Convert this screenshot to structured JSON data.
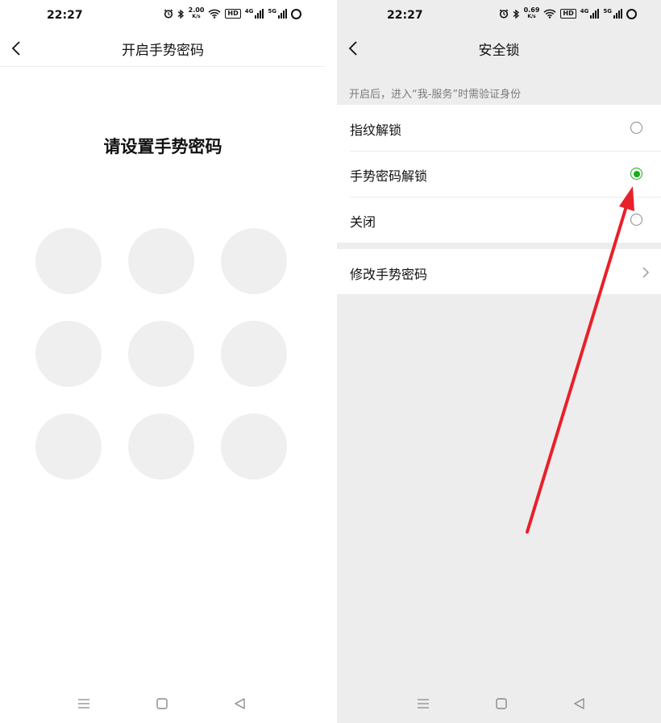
{
  "left": {
    "status": {
      "time": "22:27",
      "speed_value": "2.00",
      "speed_unit": "K/s",
      "hd": "HD",
      "net1": "4G",
      "net2": "5G"
    },
    "title": "开启手势密码",
    "prompt": "请设置手势密码",
    "pattern_dots": 9
  },
  "right": {
    "status": {
      "time": "22:27",
      "speed_value": "0.69",
      "speed_unit": "K/s",
      "hd": "HD",
      "net1": "4G",
      "net2": "5G"
    },
    "title": "安全锁",
    "hint": "开启后，进入“我-服务”时需验证身份",
    "options": [
      {
        "label": "指纹解锁",
        "selected": false
      },
      {
        "label": "手势密码解锁",
        "selected": true
      },
      {
        "label": "关闭",
        "selected": false
      }
    ],
    "modify_label": "修改手势密码"
  },
  "colors": {
    "accent": "#1aad19",
    "annotation_arrow": "#e8202a",
    "right_bg": "#ededed",
    "dot": "#efefef"
  },
  "icons": [
    "back-icon",
    "alarm-icon",
    "bluetooth-icon",
    "wifi-icon",
    "signal-icon",
    "battery-ring-icon",
    "chevron-right-icon",
    "menu-icon",
    "home-icon",
    "back-triangle-icon"
  ]
}
